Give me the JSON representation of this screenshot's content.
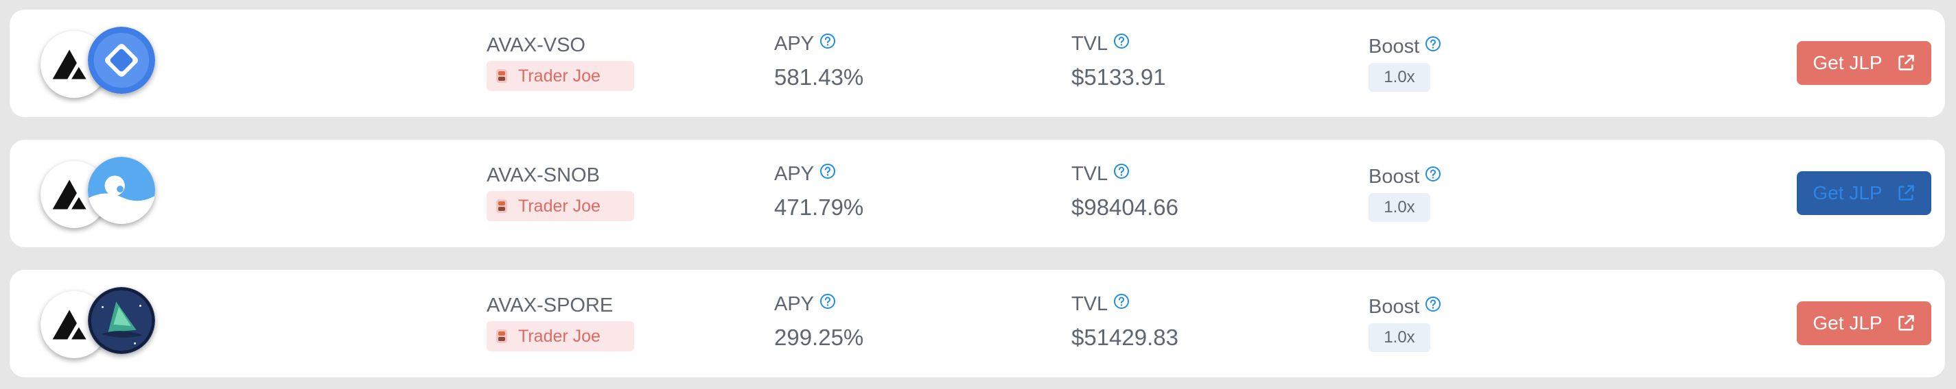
{
  "pools": [
    {
      "pair": "AVAX-VSO",
      "dex": "Trader Joe",
      "apy_label": "APY",
      "apy": "581.43%",
      "tvl_label": "TVL",
      "tvl": "$5133.91",
      "boost_label": "Boost",
      "boost": "1.0x",
      "button": "Get JLP",
      "button_state": "default"
    },
    {
      "pair": "AVAX-SNOB",
      "dex": "Trader Joe",
      "apy_label": "APY",
      "apy": "471.79%",
      "tvl_label": "TVL",
      "tvl": "$98404.66",
      "boost_label": "Boost",
      "boost": "1.0x",
      "button": "Get JLP",
      "button_state": "hover"
    },
    {
      "pair": "AVAX-SPORE",
      "dex": "Trader Joe",
      "apy_label": "APY",
      "apy": "299.25%",
      "tvl_label": "TVL",
      "tvl": "$51429.83",
      "boost_label": "Boost",
      "boost": "1.0x",
      "button": "Get JLP",
      "button_state": "default"
    }
  ],
  "colors": {
    "button_default": "#e37369",
    "button_hover": "#2a5ea7",
    "dex_badge_bg": "#fbe7e7",
    "dex_badge_text": "#e06a63",
    "help_icon": "#1f8ee6",
    "boost_badge_bg": "#e9f1f8"
  },
  "icons": {
    "base_token": "avax-logo-icon",
    "tokens": [
      "vso-logo-icon",
      "snob-logo-icon",
      "spore-logo-icon"
    ],
    "dex": "trader-joe-icon",
    "help": "help-circle-icon",
    "button": "external-link-icon"
  }
}
